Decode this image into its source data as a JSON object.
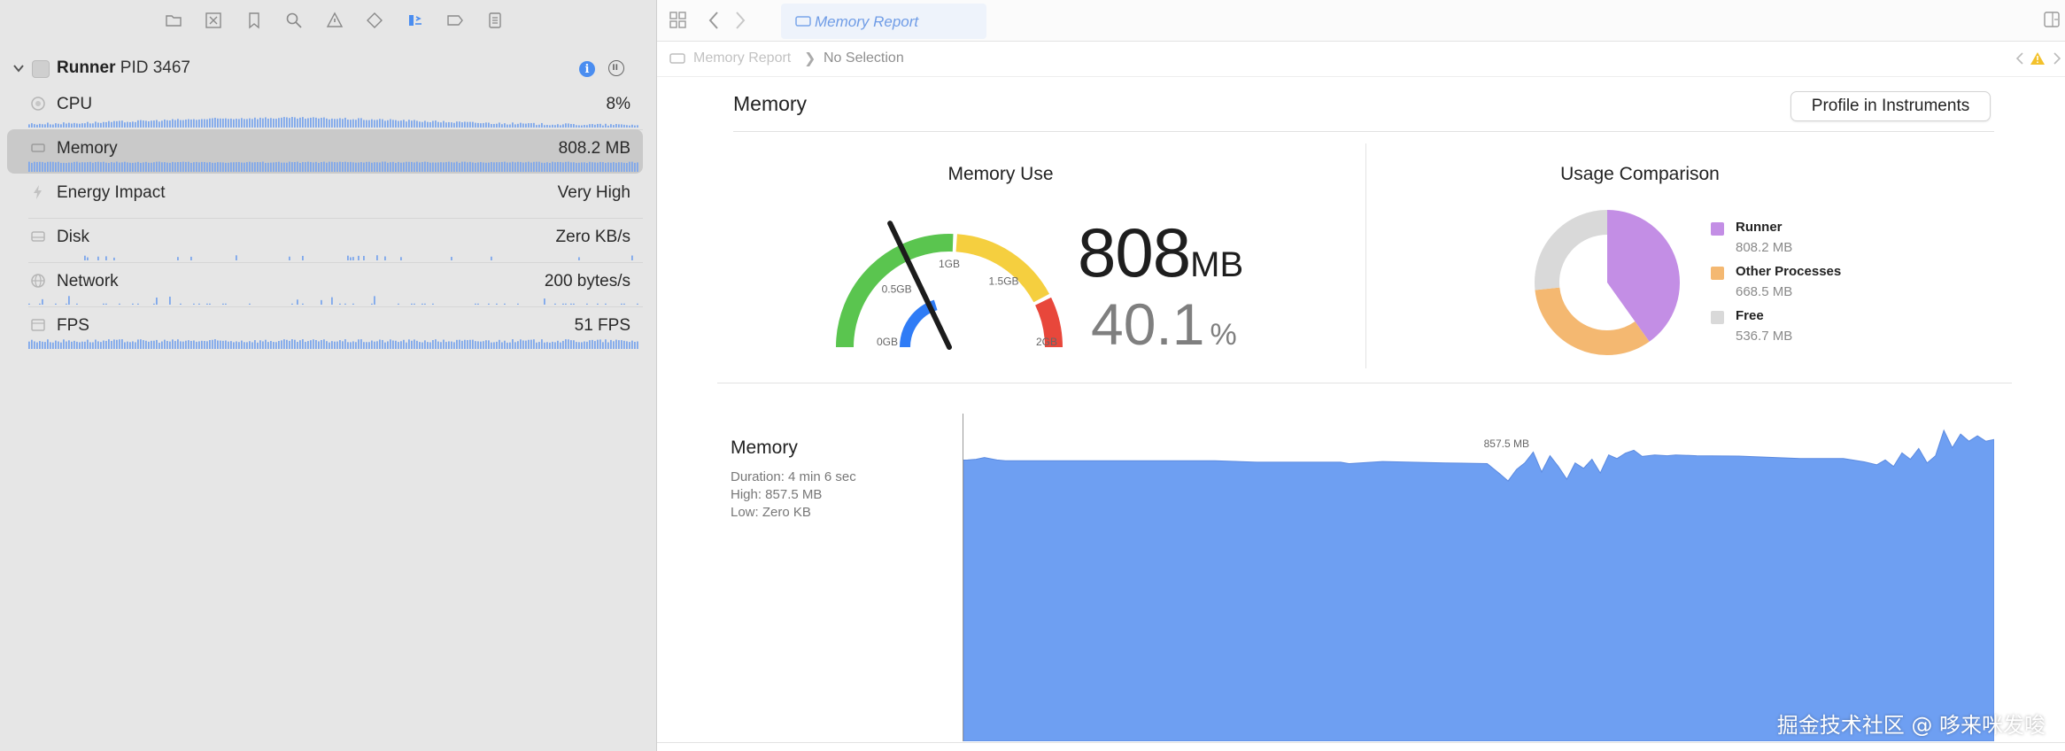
{
  "toolbar": {
    "icons": [
      "folder-icon",
      "close-square-icon",
      "bookmark-icon",
      "search-icon",
      "warning-icon",
      "tag-icon",
      "debug-navigator-icon",
      "breakpoint-icon",
      "report-icon"
    ]
  },
  "process": {
    "name": "Runner",
    "pid": "PID 3467"
  },
  "gauges": [
    {
      "label": "CPU",
      "value": "8%"
    },
    {
      "label": "Memory",
      "value": "808.2 MB"
    },
    {
      "label": "Energy Impact",
      "value": "Very High"
    },
    {
      "label": "Disk",
      "value": "Zero KB/s"
    },
    {
      "label": "Network",
      "value": "200 bytes/s"
    },
    {
      "label": "FPS",
      "value": "51 FPS"
    }
  ],
  "tab": {
    "label": "Memory Report"
  },
  "jumpbar": {
    "crumb1": "Memory Report",
    "crumb2": "No Selection"
  },
  "report": {
    "title": "Memory",
    "profile_button": "Profile in Instruments"
  },
  "memory_use": {
    "title": "Memory Use",
    "value": "808",
    "unit": "MB",
    "percent": "40.1",
    "percent_sign": "%",
    "gauge_labels": [
      "0GB",
      "0.5GB",
      "1GB",
      "1.5GB",
      "2GB"
    ],
    "usage_fraction": 0.401,
    "colors": {
      "green": "#5ac54f",
      "yellow": "#f5cf3f",
      "red": "#e8473b",
      "blue": "#2f7cf6"
    }
  },
  "usage": {
    "title": "Usage Comparison",
    "items": [
      {
        "name": "Runner",
        "value": "808.2 MB",
        "mb": 808.2,
        "color": "#c38ee5"
      },
      {
        "name": "Other Processes",
        "value": "668.5 MB",
        "mb": 668.5,
        "color": "#f4b871"
      },
      {
        "name": "Free",
        "value": "536.7 MB",
        "mb": 536.7,
        "color": "#d9d9d9"
      }
    ]
  },
  "timeline": {
    "title": "Memory",
    "duration": "Duration: 4 min 6 sec",
    "high": "High: 857.5 MB",
    "low": "Low: Zero KB",
    "axis_max_label": "857.5 MB",
    "fill_color": "#6e9ff2"
  },
  "chart_data": {
    "type": "area",
    "title": "Memory",
    "xlabel": "",
    "ylabel": "",
    "x_range_sec": [
      0,
      246
    ],
    "ylim": [
      0,
      857.5
    ],
    "series": [
      {
        "name": "Memory",
        "x": [
          0,
          1,
          3,
          5,
          8,
          10,
          20,
          35,
          50,
          60,
          70,
          90,
          92,
          100,
          115,
          125,
          128,
          130,
          132,
          134,
          136,
          138,
          140,
          142,
          144,
          146,
          148,
          150,
          152,
          154,
          156,
          158,
          160,
          162,
          165,
          168,
          170,
          175,
          185,
          200,
          210,
          215,
          218,
          220,
          222,
          224,
          226,
          228,
          230,
          232,
          234,
          236,
          238,
          240,
          242,
          244,
          246
        ],
        "values": [
          0,
          778,
          780,
          785,
          778,
          776,
          776,
          776,
          776,
          776,
          772,
          772,
          768,
          774,
          770,
          768,
          740,
          720,
          752,
          770,
          800,
          745,
          790,
          760,
          725,
          770,
          755,
          780,
          742,
          792,
          782,
          797,
          805,
          788,
          792,
          790,
          792,
          790,
          789,
          782,
          782,
          773,
          765,
          778,
          760,
          798,
          780,
          810,
          770,
          790,
          860,
          812,
          850,
          830,
          845,
          830,
          835
        ]
      }
    ]
  }
}
